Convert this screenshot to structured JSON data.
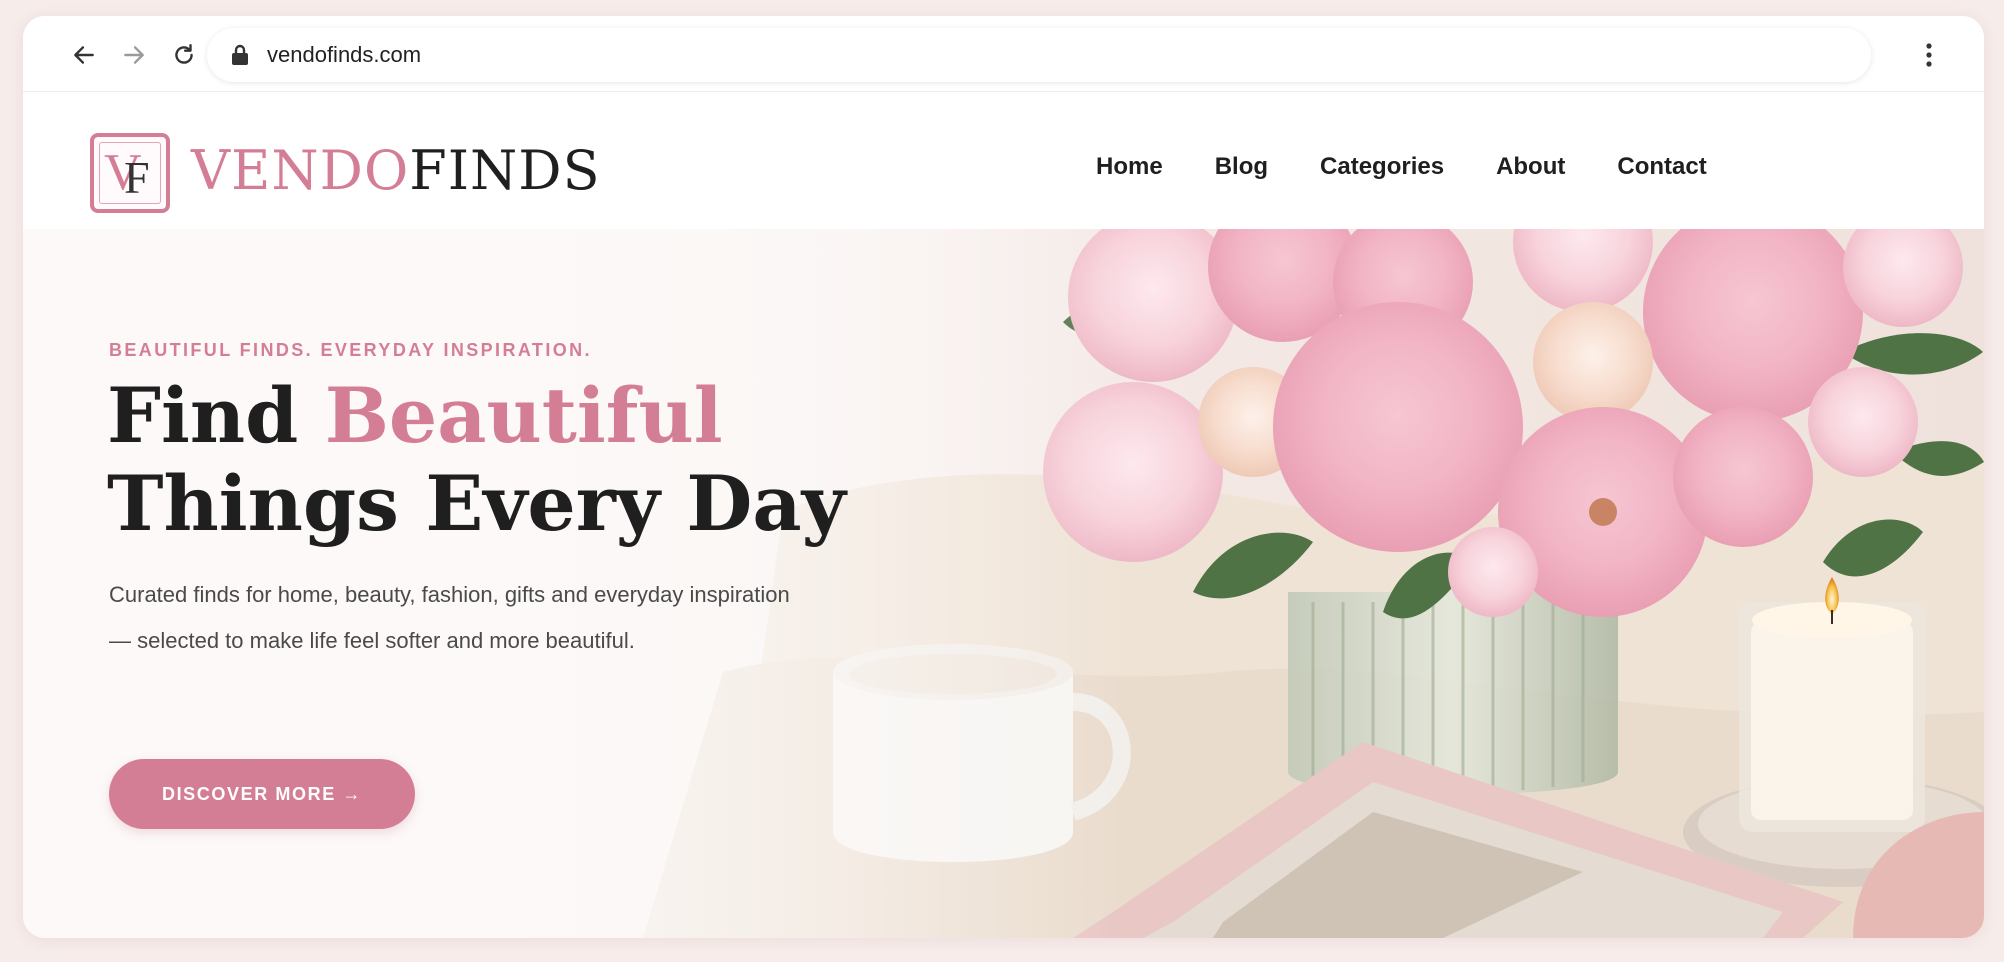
{
  "browser": {
    "url": "vendofinds.com",
    "icons": [
      "back-arrow-icon",
      "forward-arrow-icon",
      "reload-icon",
      "lock-icon",
      "kebab-menu-icon"
    ]
  },
  "site": {
    "logo_mark": "VF",
    "brand_part1": "VENDO",
    "brand_part2": "FINDS",
    "nav": [
      "Home",
      "Blog",
      "Categories",
      "About",
      "Contact"
    ]
  },
  "hero": {
    "tagline": "BEAUTIFUL FINDS. EVERYDAY INSPIRATION.",
    "headline_plain": "Find ",
    "headline_accent": "Beautiful",
    "headline_line2": "Things Every Day",
    "description": "Curated finds for home, beauty, fashion, gifts and everyday inspiration — selected to make life feel softer and more beautiful.",
    "cta_label": "DISCOVER MORE →"
  },
  "colors": {
    "accent": "#d47e95",
    "text_dark": "#1f1f1f",
    "text_body": "#4a4a4a",
    "page_bg": "#f6ecea"
  }
}
